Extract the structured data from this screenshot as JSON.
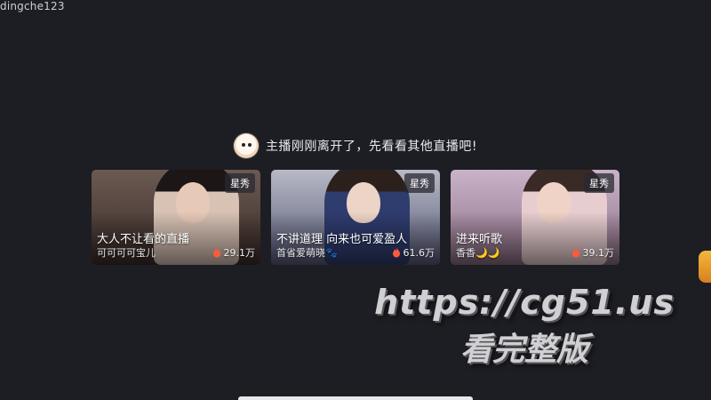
{
  "corner_id": "dingche123",
  "notice": {
    "text": "主播刚刚离开了，先看看其他直播吧!",
    "avatar_icon": "host-avatar-icon"
  },
  "cards": [
    {
      "tag": "星秀",
      "title": "大人不让看的直播",
      "host": "可可可可宝儿",
      "viewers": "29.1万",
      "colors": {
        "bg_top": "#6b5a52",
        "bg_bottom": "#3a2c28",
        "hair": "#1c1616",
        "skin": "#e7c9b7",
        "cloth": "#d7c2b4"
      }
    },
    {
      "tag": "星秀",
      "title": "不讲道理 向来也可爱盈人",
      "host": "首省爱萌晓🐾",
      "viewers": "61.6万",
      "colors": {
        "bg_top": "#b7b9c6",
        "bg_bottom": "#585a78",
        "hair": "#2b201c",
        "skin": "#ecd4c6",
        "cloth": "#2f3c6e"
      }
    },
    {
      "tag": "星秀",
      "title": "进来听歌",
      "host": "香香🌙🌙",
      "viewers": "39.1万",
      "colors": {
        "bg_top": "#c9b3c9",
        "bg_bottom": "#8c6f84",
        "hair": "#3a2a26",
        "skin": "#efd3c6",
        "cloth": "#e8cdd0"
      }
    }
  ],
  "watermark": {
    "url": "https://cg51.us",
    "sub": "看完整版"
  },
  "colors": {
    "background": "#1d1d24",
    "flame": "#ff5a3c"
  }
}
